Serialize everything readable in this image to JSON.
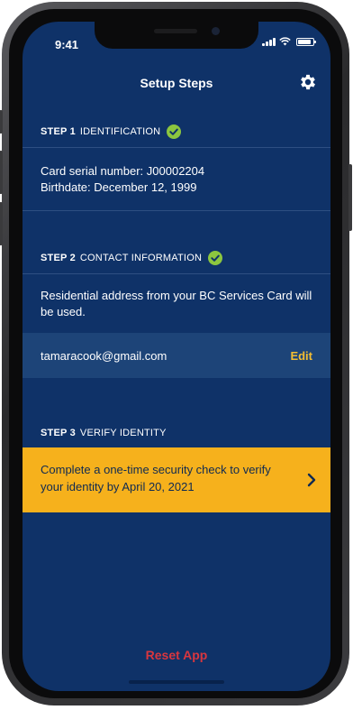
{
  "status_bar": {
    "time": "9:41"
  },
  "header": {
    "title": "Setup Steps",
    "settings_icon": "gear-icon"
  },
  "steps": [
    {
      "number": "STEP 1",
      "name": "IDENTIFICATION",
      "complete": true,
      "lines": [
        "Card serial number: J00002204",
        "Birthdate: December 12, 1999"
      ]
    },
    {
      "number": "STEP 2",
      "name": "CONTACT INFORMATION",
      "complete": true,
      "lines": [
        "Residential address from your BC Services Card will be used."
      ],
      "email": "tamaracook@gmail.com",
      "edit_label": "Edit"
    },
    {
      "number": "STEP 3",
      "name": "VERIFY IDENTITY",
      "complete": false,
      "cta_text": "Complete a one-time security check to verify your identity by April 20, 2021"
    }
  ],
  "footer": {
    "reset_label": "Reset App"
  },
  "colors": {
    "background": "#0f3268",
    "accent": "#f6b11c",
    "success": "#8cc63f",
    "danger": "#d9363e",
    "link": "#f3bd32"
  }
}
